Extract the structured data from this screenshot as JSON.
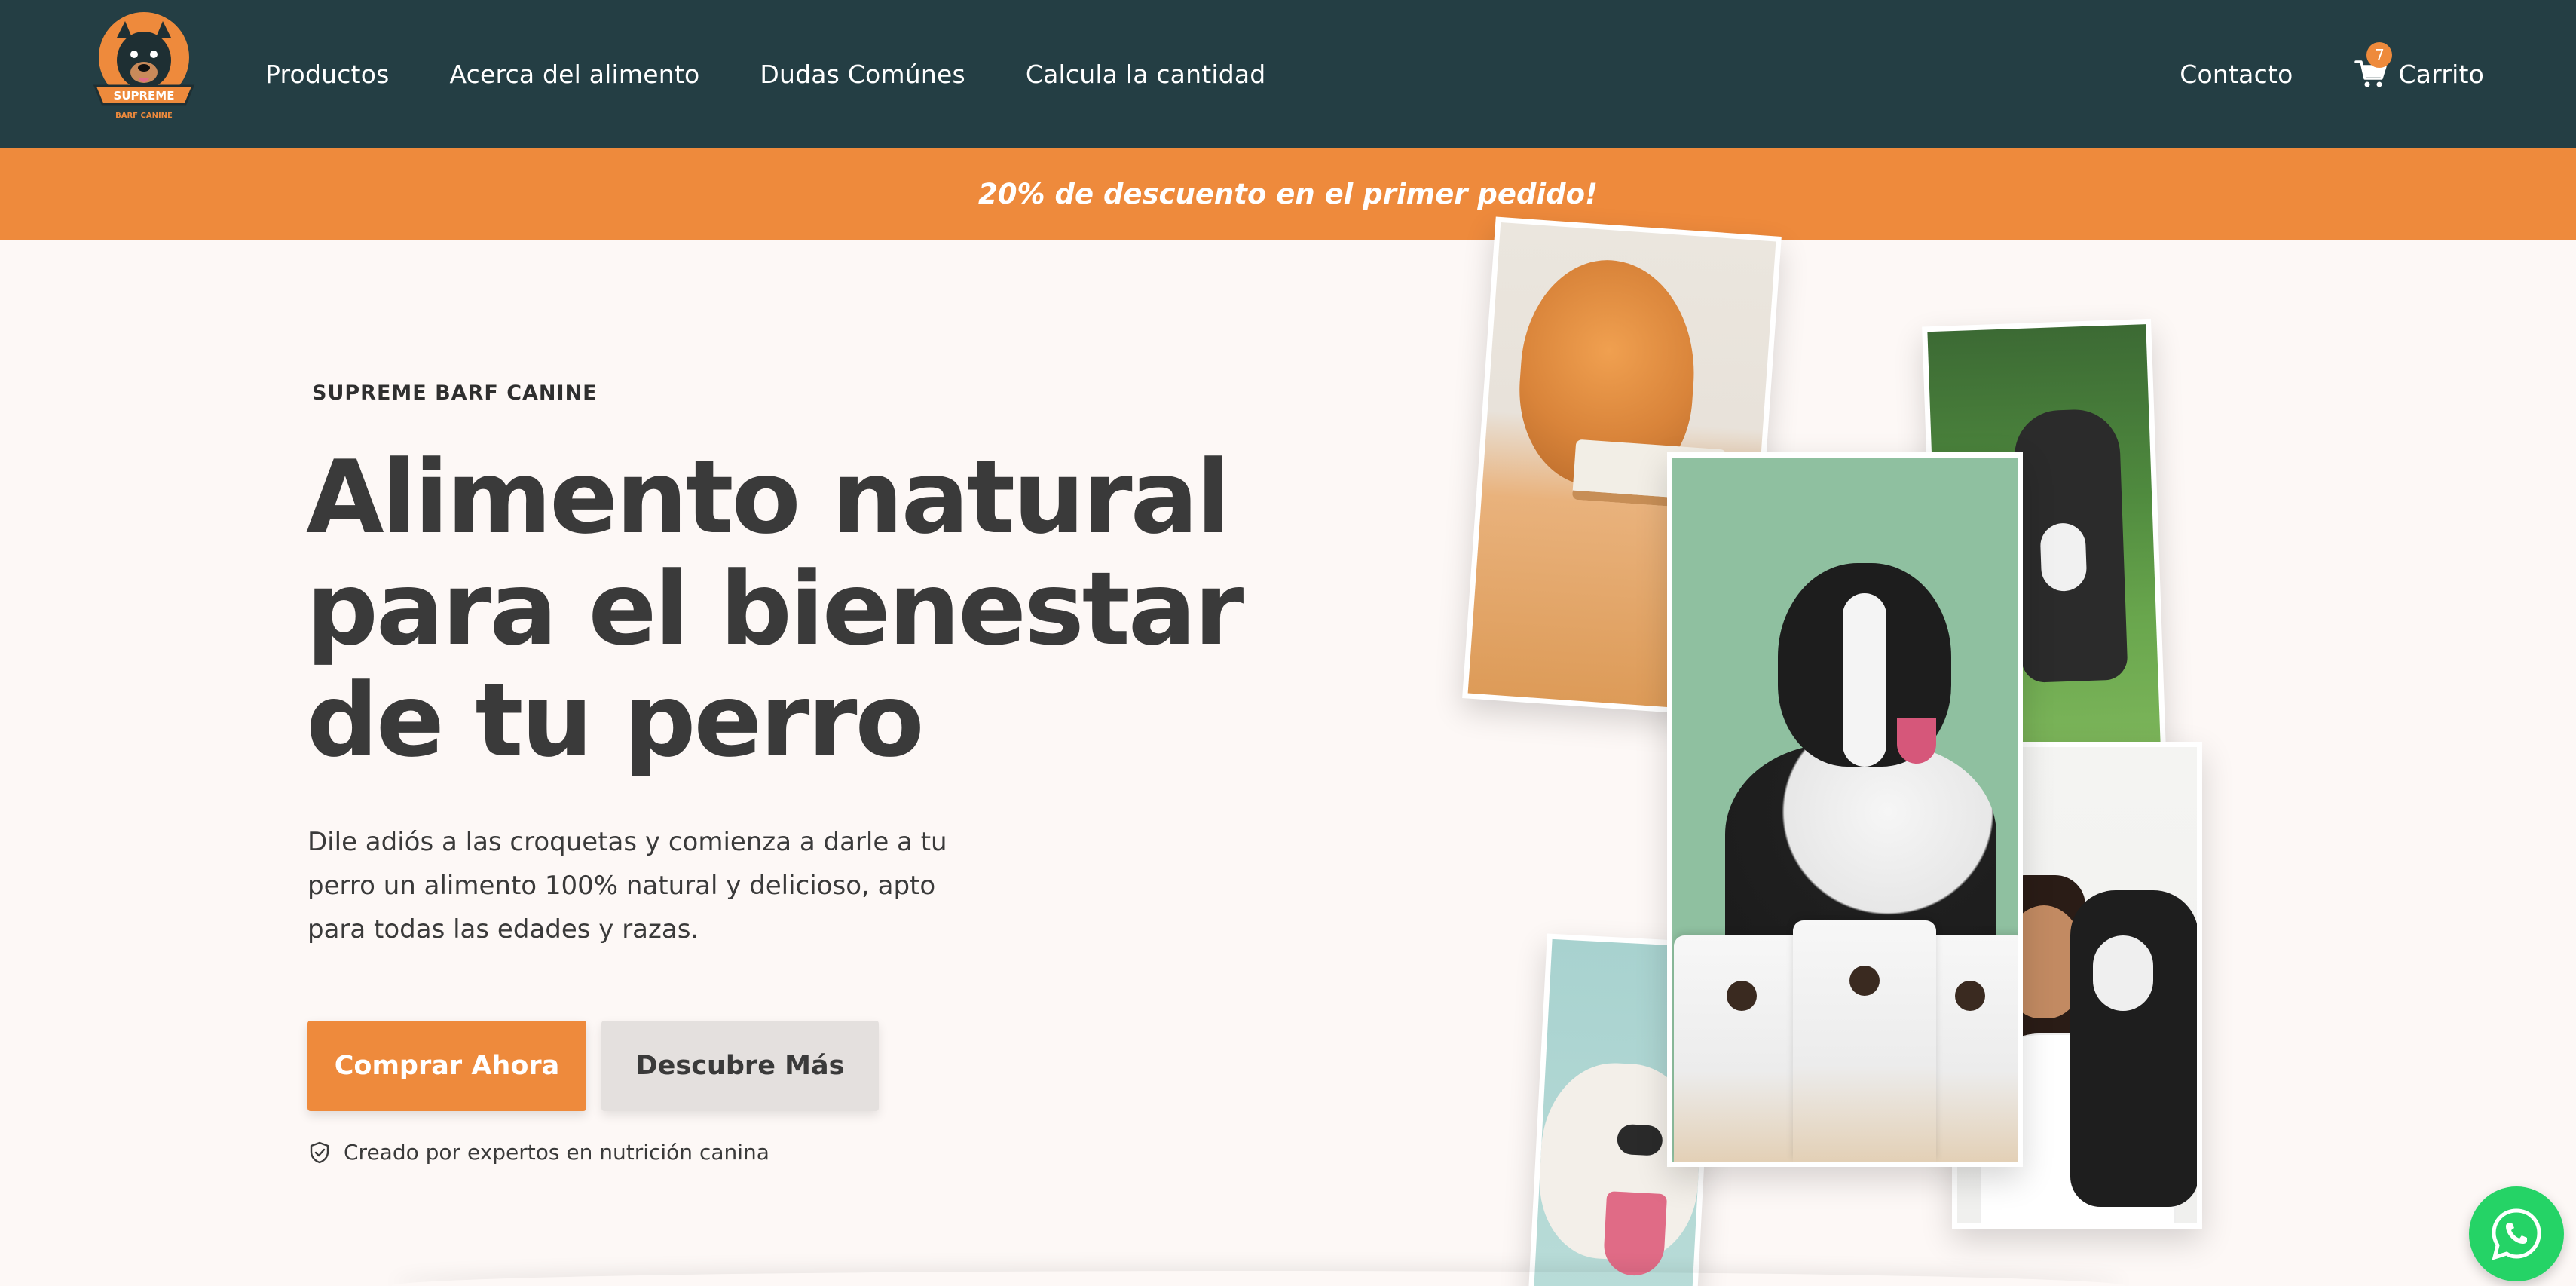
{
  "header": {
    "logo_icon": "supreme-barf-canine-logo",
    "logo_text": "SUPREME",
    "logo_subtext": "BARF CANINE",
    "nav": [
      {
        "label": "Productos"
      },
      {
        "label": "Acerca del alimento"
      },
      {
        "label": "Dudas Comúnes"
      },
      {
        "label": "Calcula la cantidad"
      }
    ],
    "contact_label": "Contacto",
    "cart_label": "Carrito",
    "cart_count": "7",
    "cart_icon": "cart-icon"
  },
  "promo": {
    "text": "20% de descuento en el primer pedido!"
  },
  "hero": {
    "eyebrow": "SUPREME BARF CANINE",
    "headline_lines": [
      "Alimento natural",
      "para el bienestar",
      "de tu perro"
    ],
    "subtext": "Dile adiós a las croquetas y comienza a darle a tu perro un alimento 100% natural y delicioso, apto para todas las edades y razas.",
    "primary_button": "Comprar Ahora",
    "secondary_button": "Descubre Más",
    "trust_text": "Creado por expertos en nutrición canina",
    "trust_icon": "shield-check-icon"
  },
  "colors": {
    "header_bg": "#243e44",
    "accent": "#ee8a3c",
    "page_bg": "#fdf8f6",
    "secondary_btn": "#e4e0de"
  },
  "floating": {
    "whatsapp_icon": "whatsapp-icon"
  }
}
